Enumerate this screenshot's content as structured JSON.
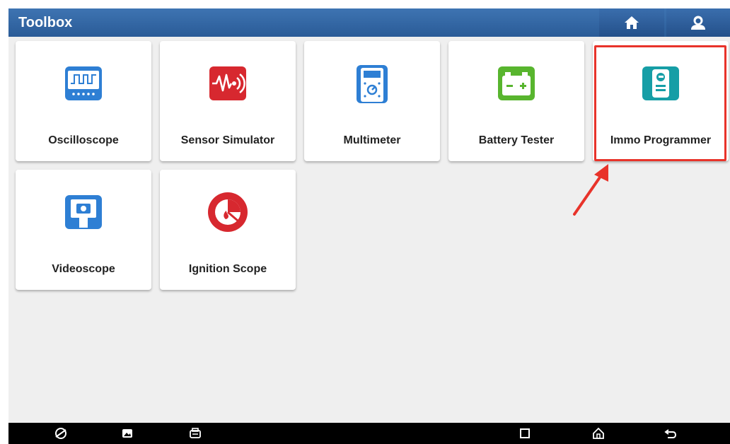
{
  "header": {
    "title": "Toolbox",
    "home_icon": "home-icon",
    "user_icon": "user-icon",
    "color": "#2f61a0"
  },
  "tools": [
    {
      "label": "Oscilloscope",
      "icon": "oscilloscope-icon",
      "color": "#2e7fd4"
    },
    {
      "label": "Sensor Simulator",
      "icon": "sensor-simulator-icon",
      "color": "#d7282f"
    },
    {
      "label": "Multimeter",
      "icon": "multimeter-icon",
      "color": "#2e7fd4"
    },
    {
      "label": "Battery Tester",
      "icon": "battery-icon",
      "color": "#58b52e"
    },
    {
      "label": "Immo Programmer",
      "icon": "immo-programmer-icon",
      "color": "#169ea6"
    },
    {
      "label": "Videoscope",
      "icon": "videoscope-icon",
      "color": "#2e7fd4"
    },
    {
      "label": "Ignition Scope",
      "icon": "ignition-scope-icon",
      "color": "#d7282f"
    }
  ],
  "annotation": {
    "highlight_color": "#e8332a",
    "highlighted_tool": "Immo Programmer"
  },
  "navbar": {
    "left_icons": [
      "browser-icon",
      "gallery-icon",
      "vci-icon"
    ],
    "right_icons": [
      "recents-icon",
      "home-icon",
      "back-icon"
    ]
  }
}
